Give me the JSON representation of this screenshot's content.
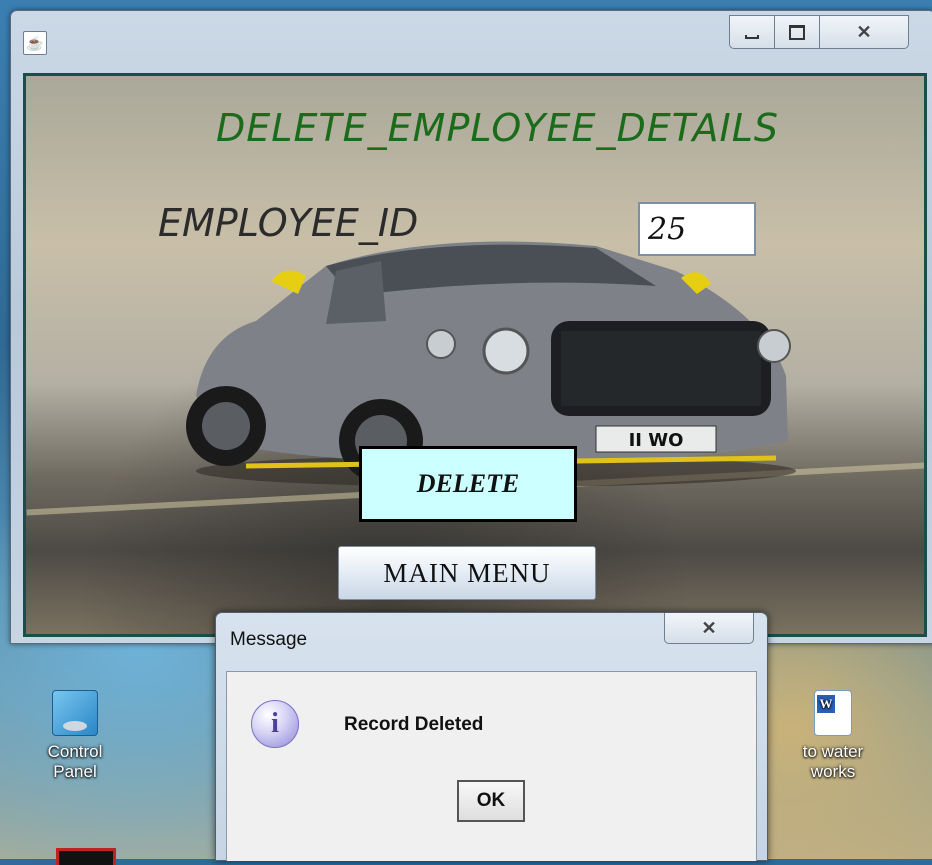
{
  "window": {
    "title_icon": "java-icon",
    "controls": {
      "minimize": "minimize-icon",
      "maximize": "maximize-icon",
      "close": "close-icon"
    }
  },
  "form": {
    "heading": "DELETE_EMPLOYEE_DETAILS",
    "employee_id_label": "EMPLOYEE_ID",
    "employee_id_value": "25",
    "delete_label": "DELETE",
    "main_menu_label": "MAIN MENU",
    "plate_text": "II WO"
  },
  "dialog": {
    "title": "Message",
    "message": "Record Deleted",
    "ok_label": "OK",
    "icon": "info-icon"
  },
  "desktop": {
    "icons": [
      {
        "label_line1": "Control",
        "label_line2": "Panel"
      },
      {
        "label_line1": "to water",
        "label_line2": "works"
      }
    ]
  },
  "colors": {
    "heading": "#1a6b1a",
    "delete_button_bg": "#ccffff",
    "content_border": "#1b4d4a"
  }
}
